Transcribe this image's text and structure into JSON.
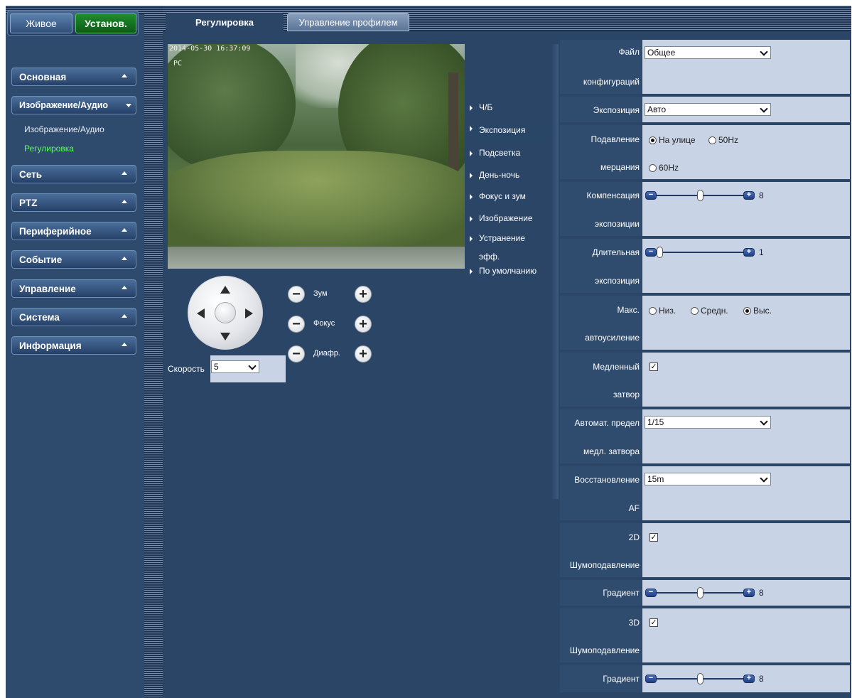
{
  "header": {
    "live_label": "Живое",
    "setup_label": "Установ."
  },
  "sidebar": {
    "items": [
      {
        "label": "Основная"
      },
      {
        "label": "Изображение/Аудио"
      },
      {
        "label": "Сеть"
      },
      {
        "label": "PTZ"
      },
      {
        "label": "Периферийное"
      },
      {
        "label": "Событие"
      },
      {
        "label": "Управление"
      },
      {
        "label": "Система"
      },
      {
        "label": "Информация"
      }
    ],
    "subitems": [
      {
        "label": "Изображение/Аудио"
      },
      {
        "label": "Регулировка"
      }
    ]
  },
  "tabs": [
    {
      "label": "Регулировка"
    },
    {
      "label": "Управление профилем"
    }
  ],
  "video": {
    "timestamp": "2014-05-30 16:37:09",
    "channel": "PC"
  },
  "ptz": {
    "zoom_label": "Зум",
    "focus_label": "Фокус",
    "iris_label": "Диафр.",
    "speed_label": "Скорость",
    "speed_value": "5"
  },
  "submenu": [
    {
      "label": "Ч/Б"
    },
    {
      "label": "Экспозиция"
    },
    {
      "label": "Подсветка"
    },
    {
      "label": "День-ночь"
    },
    {
      "label": "Фокус и зум"
    },
    {
      "label": "Изображение"
    },
    {
      "label": "Устранение"
    },
    {
      "label": "эфф."
    },
    {
      "label": "По умолчанию"
    }
  ],
  "settings": {
    "config_file": {
      "label1": "Файл",
      "label2": "конфигураций",
      "value": "Общее"
    },
    "exposure": {
      "label": "Экспозиция",
      "value": "Авто"
    },
    "flicker": {
      "label1": "Подавление",
      "label2": "мерцания",
      "opt_outdoor": "На улице",
      "opt_50": "50Hz",
      "opt_60": "60Hz"
    },
    "exp_comp": {
      "label1": "Компенсация",
      "label2": "экспозиции",
      "value": "8"
    },
    "long_exp": {
      "label1": "Длительная",
      "label2": "экспозиция",
      "value": "1"
    },
    "max_gain": {
      "label1": "Макс.",
      "label2": "автоусиление",
      "opt_low": "Низ.",
      "opt_mid": "Средн.",
      "opt_high": "Выс."
    },
    "slow_shutter": {
      "label1": "Медленный",
      "label2": "затвор"
    },
    "slow_shutter_limit": {
      "label1": "Автомат. предел",
      "label2": "медл. затвора",
      "value": "1/15"
    },
    "af_recovery": {
      "label1": "Восстановление",
      "label2": "AF",
      "value": "15m"
    },
    "nr2d": {
      "label1": "2D",
      "label2": "Шумоподавление"
    },
    "nr2d_grad": {
      "label": "Градиент",
      "value": "8"
    },
    "nr3d": {
      "label1": "3D",
      "label2": "Шумоподавление"
    },
    "nr3d_grad": {
      "label": "Градиент",
      "value": "8"
    }
  }
}
